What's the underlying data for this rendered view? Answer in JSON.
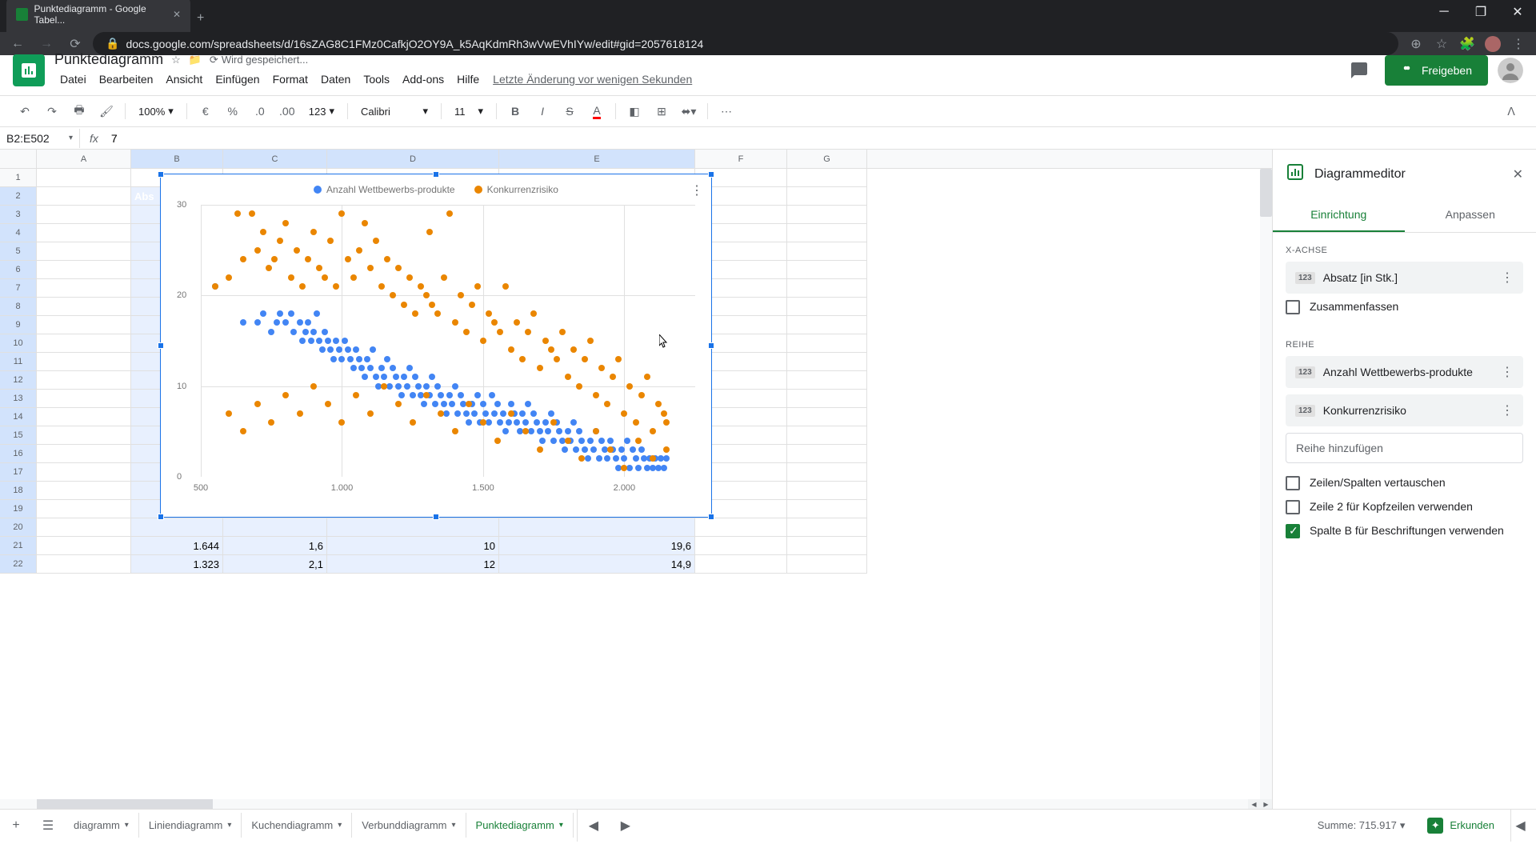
{
  "browser": {
    "tab_title": "Punktediagramm - Google Tabel...",
    "url": "docs.google.com/spreadsheets/d/16sZAG8C1FMz0CafkjO2OY9A_k5AqKdmRh3wVwEVhIYw/edit#gid=2057618124"
  },
  "doc": {
    "title": "Punktediagramm",
    "saving": "Wird gespeichert...",
    "share": "Freigeben",
    "last_edit": "Letzte Änderung vor wenigen Sekunden"
  },
  "menu": [
    "Datei",
    "Bearbeiten",
    "Ansicht",
    "Einfügen",
    "Format",
    "Daten",
    "Tools",
    "Add-ons",
    "Hilfe"
  ],
  "toolbar": {
    "zoom": "100%",
    "currency": "€",
    "percent": "%",
    "format123": "123",
    "font": "Calibri",
    "fontsize": "11"
  },
  "formula": {
    "range": "B2:E502",
    "value": "7"
  },
  "columns": [
    "A",
    "B",
    "C",
    "D",
    "E",
    "F",
    "G"
  ],
  "header_b": "Abs",
  "visible_rows": [
    {
      "n": 20,
      "b": "",
      "c": "",
      "d": "",
      "e": ""
    },
    {
      "n": 21,
      "b": "1.644",
      "c": "1,6",
      "d": "10",
      "e": "19,6"
    },
    {
      "n": 22,
      "b": "1.323",
      "c": "2,1",
      "d": "12",
      "e": "14,9"
    }
  ],
  "chart_data": {
    "type": "scatter",
    "title": "",
    "xlabel": "",
    "ylabel": "",
    "xlim": [
      500,
      2200
    ],
    "ylim": [
      0,
      30
    ],
    "x_ticks": [
      500,
      1000,
      1500,
      2000
    ],
    "y_ticks": [
      0,
      10,
      20,
      30
    ],
    "x_tick_labels": [
      "500",
      "1.000",
      "1.500",
      "2.000"
    ],
    "y_tick_labels": [
      "0",
      "10",
      "20",
      "30"
    ],
    "series": [
      {
        "name": "Anzahl Wettbewerbs-produkte",
        "color": "#4285f4",
        "points": [
          [
            550,
            21
          ],
          [
            650,
            17
          ],
          [
            700,
            17
          ],
          [
            720,
            18
          ],
          [
            750,
            16
          ],
          [
            770,
            17
          ],
          [
            780,
            18
          ],
          [
            800,
            17
          ],
          [
            820,
            18
          ],
          [
            830,
            16
          ],
          [
            850,
            17
          ],
          [
            860,
            15
          ],
          [
            870,
            16
          ],
          [
            880,
            17
          ],
          [
            890,
            15
          ],
          [
            900,
            16
          ],
          [
            910,
            18
          ],
          [
            920,
            15
          ],
          [
            930,
            14
          ],
          [
            940,
            16
          ],
          [
            950,
            15
          ],
          [
            960,
            14
          ],
          [
            970,
            13
          ],
          [
            980,
            15
          ],
          [
            990,
            14
          ],
          [
            1000,
            13
          ],
          [
            1010,
            15
          ],
          [
            1020,
            14
          ],
          [
            1030,
            13
          ],
          [
            1040,
            12
          ],
          [
            1050,
            14
          ],
          [
            1060,
            13
          ],
          [
            1070,
            12
          ],
          [
            1080,
            11
          ],
          [
            1090,
            13
          ],
          [
            1100,
            12
          ],
          [
            1110,
            14
          ],
          [
            1120,
            11
          ],
          [
            1130,
            10
          ],
          [
            1140,
            12
          ],
          [
            1150,
            11
          ],
          [
            1160,
            13
          ],
          [
            1170,
            10
          ],
          [
            1180,
            12
          ],
          [
            1190,
            11
          ],
          [
            1200,
            10
          ],
          [
            1210,
            9
          ],
          [
            1220,
            11
          ],
          [
            1230,
            10
          ],
          [
            1240,
            12
          ],
          [
            1250,
            9
          ],
          [
            1260,
            11
          ],
          [
            1270,
            10
          ],
          [
            1280,
            9
          ],
          [
            1290,
            8
          ],
          [
            1300,
            10
          ],
          [
            1310,
            9
          ],
          [
            1320,
            11
          ],
          [
            1330,
            8
          ],
          [
            1340,
            10
          ],
          [
            1350,
            9
          ],
          [
            1360,
            8
          ],
          [
            1370,
            7
          ],
          [
            1380,
            9
          ],
          [
            1390,
            8
          ],
          [
            1400,
            10
          ],
          [
            1410,
            7
          ],
          [
            1420,
            9
          ],
          [
            1430,
            8
          ],
          [
            1440,
            7
          ],
          [
            1450,
            6
          ],
          [
            1460,
            8
          ],
          [
            1470,
            7
          ],
          [
            1480,
            9
          ],
          [
            1490,
            6
          ],
          [
            1500,
            8
          ],
          [
            1510,
            7
          ],
          [
            1520,
            6
          ],
          [
            1530,
            9
          ],
          [
            1540,
            7
          ],
          [
            1550,
            8
          ],
          [
            1560,
            6
          ],
          [
            1570,
            7
          ],
          [
            1580,
            5
          ],
          [
            1590,
            6
          ],
          [
            1600,
            8
          ],
          [
            1610,
            7
          ],
          [
            1620,
            6
          ],
          [
            1630,
            5
          ],
          [
            1640,
            7
          ],
          [
            1650,
            6
          ],
          [
            1660,
            8
          ],
          [
            1670,
            5
          ],
          [
            1680,
            7
          ],
          [
            1690,
            6
          ],
          [
            1700,
            5
          ],
          [
            1710,
            4
          ],
          [
            1720,
            6
          ],
          [
            1730,
            5
          ],
          [
            1740,
            7
          ],
          [
            1750,
            4
          ],
          [
            1760,
            6
          ],
          [
            1770,
            5
          ],
          [
            1780,
            4
          ],
          [
            1790,
            3
          ],
          [
            1800,
            5
          ],
          [
            1810,
            4
          ],
          [
            1820,
            6
          ],
          [
            1830,
            3
          ],
          [
            1840,
            5
          ],
          [
            1850,
            4
          ],
          [
            1860,
            3
          ],
          [
            1870,
            2
          ],
          [
            1880,
            4
          ],
          [
            1890,
            3
          ],
          [
            1900,
            5
          ],
          [
            1910,
            2
          ],
          [
            1920,
            4
          ],
          [
            1930,
            3
          ],
          [
            1940,
            2
          ],
          [
            1950,
            4
          ],
          [
            1960,
            3
          ],
          [
            1970,
            2
          ],
          [
            1980,
            1
          ],
          [
            1990,
            3
          ],
          [
            2000,
            2
          ],
          [
            2010,
            4
          ],
          [
            2020,
            1
          ],
          [
            2030,
            3
          ],
          [
            2040,
            2
          ],
          [
            2050,
            1
          ],
          [
            2060,
            3
          ],
          [
            2070,
            2
          ],
          [
            2080,
            1
          ],
          [
            2090,
            2
          ],
          [
            2100,
            1
          ],
          [
            2110,
            2
          ],
          [
            2120,
            1
          ],
          [
            2130,
            2
          ],
          [
            2140,
            1
          ],
          [
            2150,
            2
          ]
        ]
      },
      {
        "name": "Konkurrenzrisiko",
        "color": "#ea8600",
        "points": [
          [
            550,
            21
          ],
          [
            600,
            22
          ],
          [
            630,
            29
          ],
          [
            650,
            24
          ],
          [
            680,
            29
          ],
          [
            700,
            25
          ],
          [
            720,
            27
          ],
          [
            740,
            23
          ],
          [
            760,
            24
          ],
          [
            780,
            26
          ],
          [
            800,
            28
          ],
          [
            820,
            22
          ],
          [
            840,
            25
          ],
          [
            860,
            21
          ],
          [
            880,
            24
          ],
          [
            900,
            27
          ],
          [
            920,
            23
          ],
          [
            940,
            22
          ],
          [
            960,
            26
          ],
          [
            980,
            21
          ],
          [
            1000,
            29
          ],
          [
            1020,
            24
          ],
          [
            1040,
            22
          ],
          [
            1060,
            25
          ],
          [
            1080,
            28
          ],
          [
            1100,
            23
          ],
          [
            1120,
            26
          ],
          [
            1140,
            21
          ],
          [
            1160,
            24
          ],
          [
            1180,
            20
          ],
          [
            1200,
            23
          ],
          [
            1220,
            19
          ],
          [
            1240,
            22
          ],
          [
            1260,
            18
          ],
          [
            1280,
            21
          ],
          [
            1300,
            20
          ],
          [
            1310,
            27
          ],
          [
            1320,
            19
          ],
          [
            1340,
            18
          ],
          [
            1360,
            22
          ],
          [
            1380,
            29
          ],
          [
            1400,
            17
          ],
          [
            1420,
            20
          ],
          [
            1440,
            16
          ],
          [
            1460,
            19
          ],
          [
            1480,
            21
          ],
          [
            1500,
            15
          ],
          [
            1520,
            18
          ],
          [
            1540,
            17
          ],
          [
            1560,
            16
          ],
          [
            1580,
            21
          ],
          [
            1600,
            14
          ],
          [
            1620,
            17
          ],
          [
            1640,
            13
          ],
          [
            1660,
            16
          ],
          [
            1680,
            18
          ],
          [
            1700,
            12
          ],
          [
            1720,
            15
          ],
          [
            1740,
            14
          ],
          [
            1760,
            13
          ],
          [
            1780,
            16
          ],
          [
            1800,
            11
          ],
          [
            1820,
            14
          ],
          [
            1840,
            10
          ],
          [
            1860,
            13
          ],
          [
            1880,
            15
          ],
          [
            1900,
            9
          ],
          [
            1920,
            12
          ],
          [
            1940,
            8
          ],
          [
            1960,
            11
          ],
          [
            1980,
            13
          ],
          [
            2000,
            7
          ],
          [
            2020,
            10
          ],
          [
            2040,
            6
          ],
          [
            2060,
            9
          ],
          [
            2080,
            11
          ],
          [
            2100,
            5
          ],
          [
            2120,
            8
          ],
          [
            2140,
            7
          ],
          [
            2150,
            6
          ],
          [
            600,
            7
          ],
          [
            650,
            5
          ],
          [
            700,
            8
          ],
          [
            750,
            6
          ],
          [
            800,
            9
          ],
          [
            850,
            7
          ],
          [
            900,
            10
          ],
          [
            950,
            8
          ],
          [
            1000,
            6
          ],
          [
            1050,
            9
          ],
          [
            1100,
            7
          ],
          [
            1150,
            10
          ],
          [
            1200,
            8
          ],
          [
            1250,
            6
          ],
          [
            1300,
            9
          ],
          [
            1350,
            7
          ],
          [
            1400,
            5
          ],
          [
            1450,
            8
          ],
          [
            1500,
            6
          ],
          [
            1550,
            4
          ],
          [
            1600,
            7
          ],
          [
            1650,
            5
          ],
          [
            1700,
            3
          ],
          [
            1750,
            6
          ],
          [
            1800,
            4
          ],
          [
            1850,
            2
          ],
          [
            1900,
            5
          ],
          [
            1950,
            3
          ],
          [
            2000,
            1
          ],
          [
            2050,
            4
          ],
          [
            2100,
            2
          ],
          [
            2150,
            3
          ]
        ]
      }
    ]
  },
  "editor": {
    "title": "Diagrammeditor",
    "tab_setup": "Einrichtung",
    "tab_customize": "Anpassen",
    "xaxis_label": "X-Achse",
    "xaxis_value": "Absatz [in Stk.]",
    "aggregate": "Zusammenfassen",
    "series_label": "Reihe",
    "series1": "Anzahl Wettbewerbs-produkte",
    "series2": "Konkurrenzrisiko",
    "add_series": "Reihe hinzufügen",
    "swap_rows": "Zeilen/Spalten vertauschen",
    "row2_headers": "Zeile 2 für Kopfzeilen verwenden",
    "colb_labels": "Spalte B für Beschriftungen verwenden"
  },
  "sheets": {
    "tabs": [
      "diagramm",
      "Liniendiagramm",
      "Kuchendiagramm",
      "Verbunddiagramm",
      "Punktediagramm"
    ],
    "active": 4,
    "sum": "Summe: 715.917",
    "explore": "Erkunden"
  }
}
